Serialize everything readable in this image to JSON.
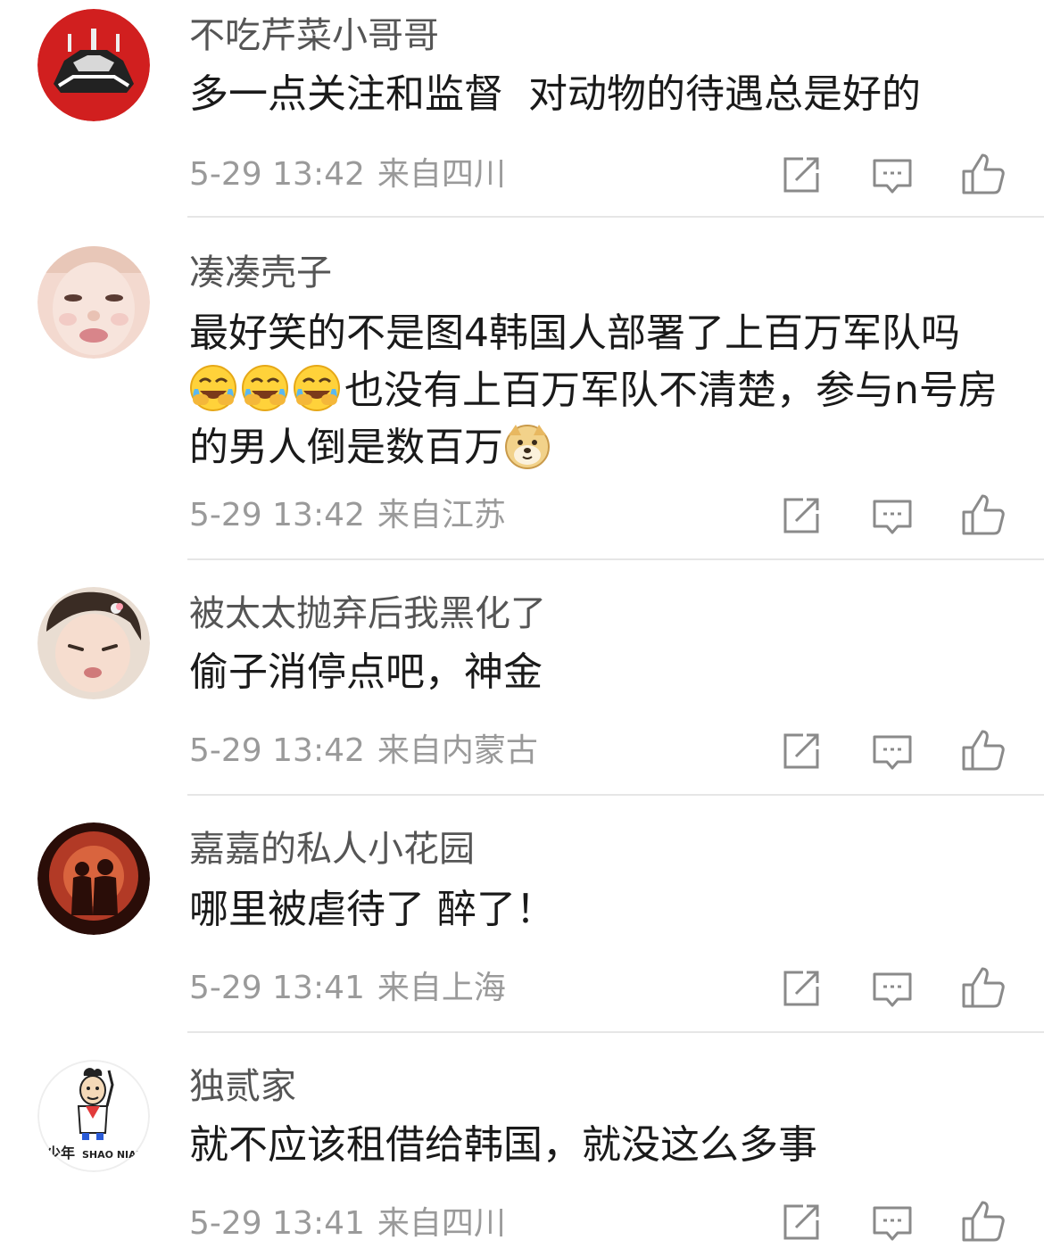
{
  "comments": [
    {
      "username": "不吃芹菜小哥哥",
      "text": "多一点关注和监督  对动物的待遇总是好的",
      "time": "5-29 13:42",
      "location": "来自四川",
      "avatar_icon": "sports-car-avatar"
    },
    {
      "username": "凑凑壳子",
      "text_before": "最好笑的不是图4韩国人部署了上百万军队吗",
      "emoji_laugh": "laughing-crying-emoji",
      "text_middle": "也没有上百万军队不清楚，参与n号房的男人倒是数百万",
      "emoji_doge": "doge-emoji",
      "time": "5-29 13:42",
      "location": "来自江苏",
      "avatar_icon": "girl-face-avatar"
    },
    {
      "username": "被太太抛弃后我黑化了",
      "text": "偷子消停点吧，神金",
      "time": "5-29 13:42",
      "location": "来自内蒙古",
      "avatar_icon": "baby-squint-avatar"
    },
    {
      "username": "嘉嘉的私人小花园",
      "text": "哪里被虐待了 醉了！",
      "time": "5-29 13:41",
      "location": "来自上海",
      "avatar_icon": "couple-silhouette-avatar"
    },
    {
      "username": "独贰家",
      "text": "就不应该租借给韩国，就没这么多事",
      "time": "5-29 13:41",
      "location": "来自四川",
      "avatar_icon": "cartoon-boy-avatar",
      "avatar_text": "少年",
      "avatar_subtext": "SHAO NIAN"
    }
  ],
  "colors": {
    "username": "#555555",
    "text": "#1a1a1a",
    "meta": "#9a9a9a",
    "divider": "#e6e6e6",
    "icon": "#8a8a8a"
  }
}
